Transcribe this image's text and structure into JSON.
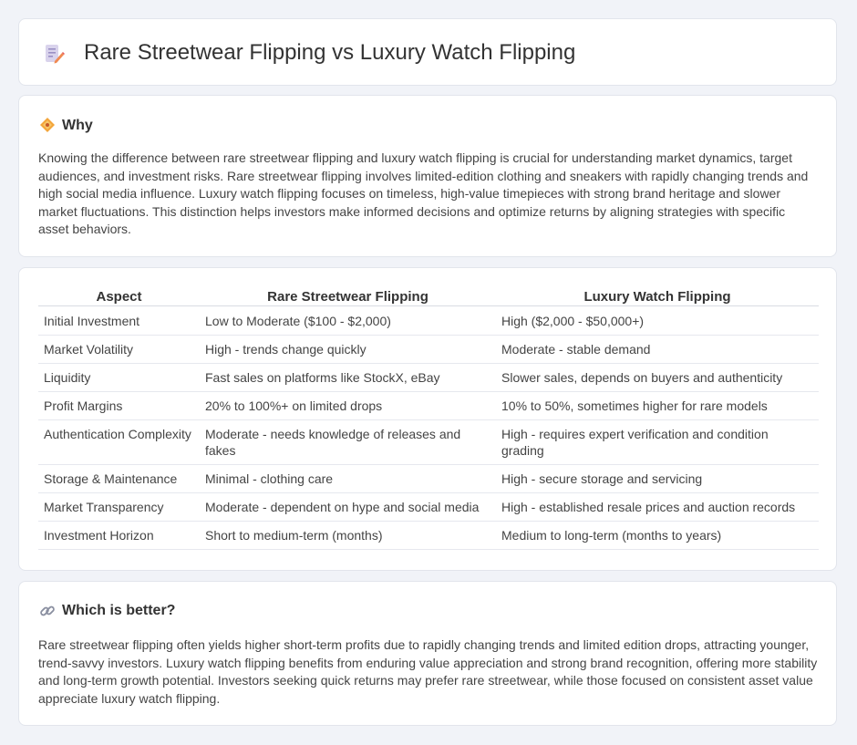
{
  "header": {
    "title": "Rare Streetwear Flipping vs Luxury Watch Flipping",
    "icon": "document-pencil-icon"
  },
  "why": {
    "heading": "Why",
    "icon": "diamond-icon",
    "body": "Knowing the difference between rare streetwear flipping and luxury watch flipping is crucial for understanding market dynamics, target audiences, and investment risks. Rare streetwear flipping involves limited-edition clothing and sneakers with rapidly changing trends and high social media influence. Luxury watch flipping focuses on timeless, high-value timepieces with strong brand heritage and slower market fluctuations. This distinction helps investors make informed decisions and optimize returns by aligning strategies with specific asset behaviors."
  },
  "comparison": {
    "headers": [
      "Aspect",
      "Rare Streetwear Flipping",
      "Luxury Watch Flipping"
    ],
    "rows": [
      [
        "Initial Investment",
        "Low to Moderate ($100 - $2,000)",
        "High ($2,000 - $50,000+)"
      ],
      [
        "Market Volatility",
        "High - trends change quickly",
        "Moderate - stable demand"
      ],
      [
        "Liquidity",
        "Fast sales on platforms like StockX, eBay",
        "Slower sales, depends on buyers and authenticity"
      ],
      [
        "Profit Margins",
        "20% to 100%+ on limited drops",
        "10% to 50%, sometimes higher for rare models"
      ],
      [
        "Authentication Complexity",
        "Moderate - needs knowledge of releases and fakes",
        "High - requires expert verification and condition grading"
      ],
      [
        "Storage & Maintenance",
        "Minimal - clothing care",
        "High - secure storage and servicing"
      ],
      [
        "Market Transparency",
        "Moderate - dependent on hype and social media",
        "High - established resale prices and auction records"
      ],
      [
        "Investment Horizon",
        "Short to medium-term (months)",
        "Medium to long-term (months to years)"
      ]
    ]
  },
  "better": {
    "heading": "Which is better?",
    "icon": "link-icon",
    "body": "Rare streetwear flipping often yields higher short-term profits due to rapidly changing trends and limited edition drops, attracting younger, trend-savvy investors. Luxury watch flipping benefits from enduring value appreciation and strong brand recognition, offering more stability and long-term growth potential. Investors seeking quick returns may prefer rare streetwear, while those focused on consistent asset value appreciate luxury watch flipping."
  }
}
